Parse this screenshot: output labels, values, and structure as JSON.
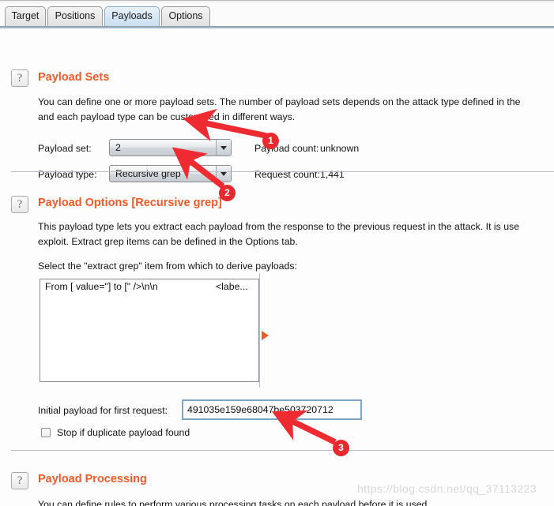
{
  "window": {
    "tabs": [
      {
        "label": "Target",
        "selected": false
      },
      {
        "label": "Positions",
        "selected": false
      },
      {
        "label": "Payloads",
        "selected": true
      },
      {
        "label": "Options",
        "selected": false
      }
    ]
  },
  "payload_sets": {
    "help_icon": "question-mark-icon",
    "title": "Payload Sets",
    "desc_line1": "You can define one or more payload sets. The number of payload sets depends on the attack type defined in the",
    "desc_line2": "and each payload type can be customized in different ways.",
    "payload_set_label": "Payload set:",
    "payload_set_value": "2",
    "payload_type_label": "Payload type:",
    "payload_type_value": "Recursive grep",
    "payload_count_label": "Payload count:",
    "payload_count_value": "unknown",
    "request_count_label": "Request count:",
    "request_count_value": "1,441"
  },
  "payload_options": {
    "help_icon": "question-mark-icon",
    "title": "Payload Options [Recursive grep]",
    "desc_line1": "This payload type lets you extract each payload from the response to the previous request in the attack. It is use",
    "desc_line2": "exploit. Extract grep items can be defined in the Options tab.",
    "select_label": "Select the \"extract grep\" item from which to derive payloads:",
    "grep_items": [
      {
        "left": "From [ value=\"] to [\" />\\n\\n",
        "right": "<labe..."
      }
    ],
    "expand_icon": "triangle-right-icon",
    "initial_payload_label": "Initial payload for first request:",
    "initial_payload_value": "491035e159e68047be503720712",
    "stop_duplicate_label": "Stop if duplicate payload found",
    "stop_duplicate_checked": false
  },
  "payload_processing": {
    "help_icon": "question-mark-icon",
    "title": "Payload Processing",
    "desc_line1": "You can define rules to perform various processing tasks on each payload before it is used."
  },
  "annotations": {
    "accent_red": "#e8292f",
    "accent_orange": "#f25a28",
    "markers": [
      {
        "number": "1"
      },
      {
        "number": "2"
      },
      {
        "number": "3"
      }
    ]
  },
  "watermark": {
    "text": "https://blog.csdn.net/qq_37113223"
  }
}
